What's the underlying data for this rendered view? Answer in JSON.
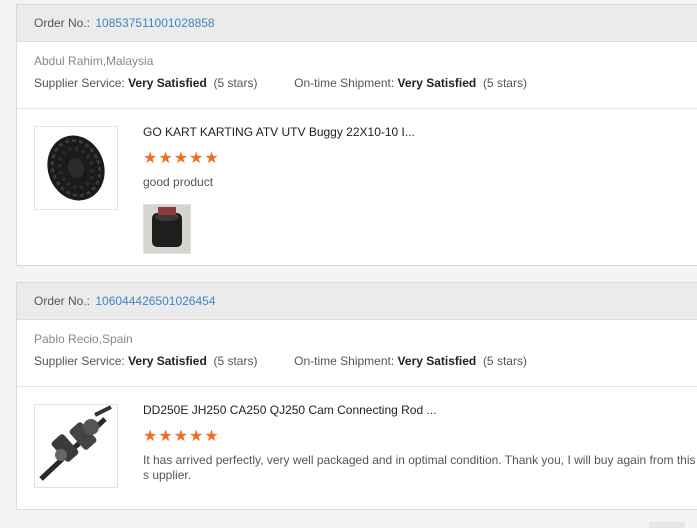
{
  "orders": [
    {
      "order_label": "Order No.:",
      "order_number": "108537511001028858",
      "buyer": "Abdul Rahim,Malaysia",
      "supplier_label": "Supplier Service:",
      "supplier_rating": "Very Satisfied",
      "supplier_stars": "(5 stars)",
      "shipment_label": "On-time Shipment:",
      "shipment_rating": "Very Satisfied",
      "shipment_stars": "(5 stars)",
      "product_title": "GO KART KARTING ATV UTV Buggy 22X10-10 I...",
      "star_rating": 5,
      "stars": "★★★★★",
      "feedback": "good product"
    },
    {
      "order_label": "Order No.:",
      "order_number": "106044426501026454",
      "buyer": "Pablo Recio,Spain",
      "supplier_label": "Supplier Service:",
      "supplier_rating": "Very Satisfied",
      "supplier_stars": "(5 stars)",
      "shipment_label": "On-time Shipment:",
      "shipment_rating": "Very Satisfied",
      "shipment_stars": "(5 stars)",
      "product_title": "DD250E JH250 CA250 QJ250 Cam Connecting Rod ...",
      "star_rating": 5,
      "stars": "★★★★★",
      "feedback": "It has arrived perfectly, very well packaged and in optimal condition. Thank you, I will buy again from this s upplier."
    }
  ],
  "colors": {
    "link": "#3d85c6",
    "star": "#f06e1f",
    "header_bg": "#ebebeb"
  },
  "icons": {
    "product1": "tire-image",
    "product2": "crankshaft-image",
    "photo1": "tire-photo"
  }
}
